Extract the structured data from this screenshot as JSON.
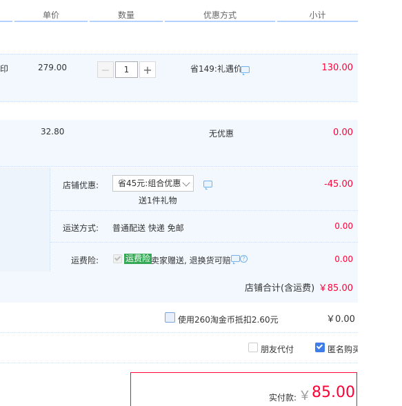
{
  "header": {
    "col_price": "单价",
    "col_qty": "数量",
    "col_discount": "优惠方式",
    "col_subtotal": "小计"
  },
  "items": [
    {
      "title_fragment": "印",
      "unit_price": "279.00",
      "quantity": "1",
      "discount": "省149:礼遇价",
      "subtotal": "130.00"
    },
    {
      "unit_price": "32.80",
      "discount": "无优惠",
      "subtotal": "0.00"
    }
  ],
  "shop": {
    "promo_label": "店铺优惠:",
    "promo_selected": "省45元:组合优惠",
    "promo_gift": "送1件礼物",
    "promo_amount": "-45.00",
    "shipping_label": "运送方式:",
    "shipping_value": "普通配送 快递 免邮",
    "shipping_amount": "0.00",
    "insurance_label": "运费险:",
    "insurance_badge": "运费险",
    "insurance_text": "卖家赠送, 退换货可赔",
    "insurance_amount": "0.00",
    "total_label": "店铺合计(含运费)",
    "total_value": "￥85.00"
  },
  "coins": {
    "label": "使用260淘金币抵扣2.60元",
    "amount": "￥0.00"
  },
  "options": {
    "friend_pay": "朋友代付",
    "anonymous": "匿名购买",
    "anonymous_checked": true,
    "friend_pay_checked": false
  },
  "payment": {
    "label": "实付款:",
    "currency": "￥",
    "amount": "85.00"
  },
  "colors": {
    "accent_red": "#ff0036",
    "accent_blue": "#3f7ee8",
    "badge_green": "#35a855"
  }
}
